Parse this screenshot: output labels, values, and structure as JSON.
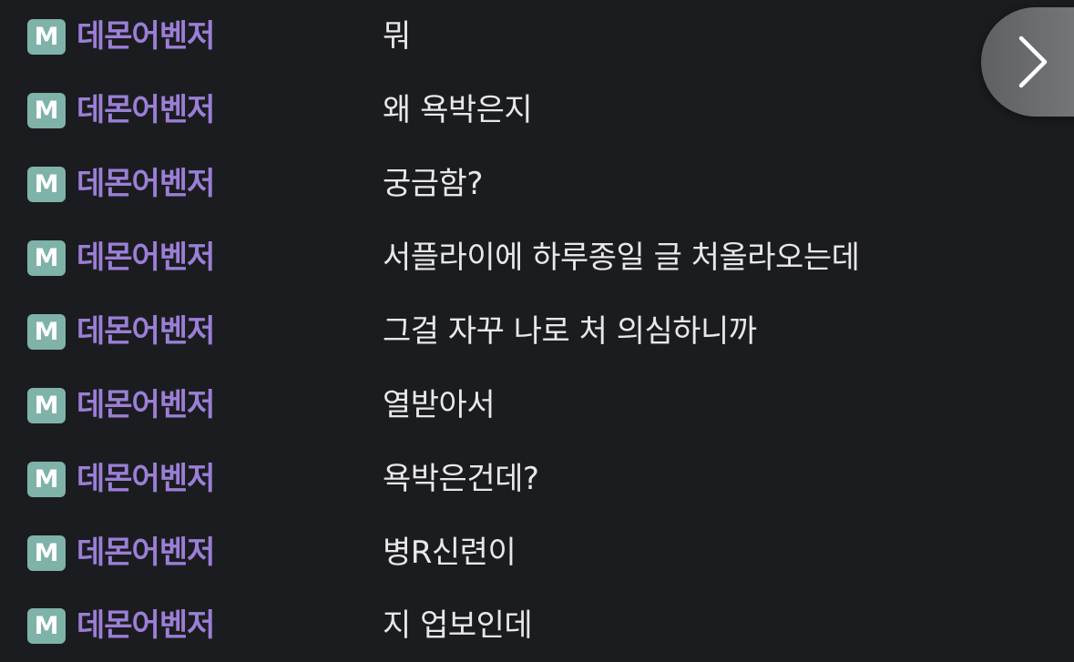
{
  "chat": {
    "messages": [
      {
        "badge": "M",
        "nickname": "데몬어벤저",
        "text": "뭐"
      },
      {
        "badge": "M",
        "nickname": "데몬어벤저",
        "text": "왜 욕박은지"
      },
      {
        "badge": "M",
        "nickname": "데몬어벤저",
        "text": "궁금함?"
      },
      {
        "badge": "M",
        "nickname": "데몬어벤저",
        "text": "서플라이에 하루종일 글 처올라오는데"
      },
      {
        "badge": "M",
        "nickname": "데몬어벤저",
        "text": "그걸 자꾸 나로 처 의심하니까"
      },
      {
        "badge": "M",
        "nickname": "데몬어벤저",
        "text": "열받아서"
      },
      {
        "badge": "M",
        "nickname": "데몬어벤저",
        "text": "욕박은건데?"
      },
      {
        "badge": "M",
        "nickname": "데몬어벤저",
        "text": "병R신련이"
      },
      {
        "badge": "M",
        "nickname": "데몬어벤저",
        "text": "지 업보인데"
      }
    ]
  },
  "controls": {
    "next_icon": "chevron-right-icon"
  },
  "colors": {
    "background": "#1b1c20",
    "badge": "#7fb2a8",
    "nickname": "#9b7fd6",
    "message_text": "#e8e8ea"
  }
}
